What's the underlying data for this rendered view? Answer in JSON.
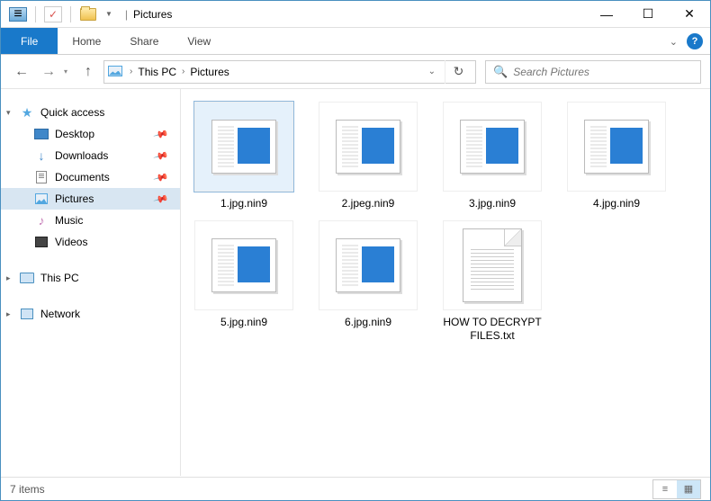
{
  "window": {
    "title": "Pictures"
  },
  "ribbon": {
    "file": "File",
    "tabs": [
      "Home",
      "Share",
      "View"
    ]
  },
  "address": {
    "segments": [
      "This PC",
      "Pictures"
    ]
  },
  "search": {
    "placeholder": "Search Pictures"
  },
  "sidebar": {
    "quick": "Quick access",
    "items": [
      {
        "label": "Desktop",
        "pinned": true
      },
      {
        "label": "Downloads",
        "pinned": true
      },
      {
        "label": "Documents",
        "pinned": true
      },
      {
        "label": "Pictures",
        "pinned": true,
        "selected": true
      },
      {
        "label": "Music",
        "pinned": false
      },
      {
        "label": "Videos",
        "pinned": false
      }
    ],
    "thispc": "This PC",
    "network": "Network"
  },
  "files": [
    {
      "name": "1.jpg.nin9",
      "type": "img",
      "selected": true
    },
    {
      "name": "2.jpeg.nin9",
      "type": "img"
    },
    {
      "name": "3.jpg.nin9",
      "type": "img"
    },
    {
      "name": "4.jpg.nin9",
      "type": "img"
    },
    {
      "name": "5.jpg.nin9",
      "type": "img"
    },
    {
      "name": "6.jpg.nin9",
      "type": "img"
    },
    {
      "name": "HOW TO DECRYPT FILES.txt",
      "type": "txt"
    }
  ],
  "status": {
    "count": "7 items"
  }
}
